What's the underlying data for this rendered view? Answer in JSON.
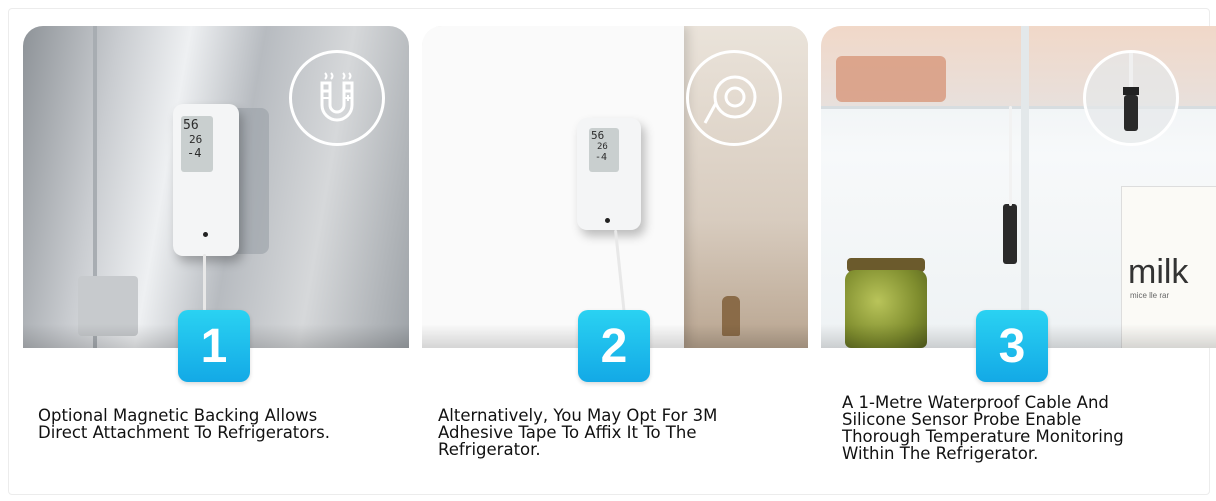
{
  "steps": [
    {
      "number": "1",
      "caption_lines": [
        "Optional Magnetic Backing Allows",
        "Direct Attachment To Refrigerators."
      ],
      "icon": "magnet-icon"
    },
    {
      "number": "2",
      "caption_lines": [
        "Alternatively, You May Opt For 3M",
        "Adhesive Tape To Affix It To The",
        "Refrigerator."
      ],
      "icon": "tape-roll-icon"
    },
    {
      "number": "3",
      "caption_lines": [
        "A 1-Metre Waterproof Cable And",
        "Silicone Sensor Probe Enable",
        "Thorough Temperature Monitoring",
        "Within The Refrigerator."
      ],
      "icon": "probe-icon"
    }
  ],
  "device_display": {
    "humidity": "56",
    "temp": "26",
    "probe_temp": "-4"
  },
  "carton_label": "milk",
  "carton_sub": "mice lle rar",
  "colors": {
    "badge": "#13a9e6",
    "text": "#111111"
  }
}
